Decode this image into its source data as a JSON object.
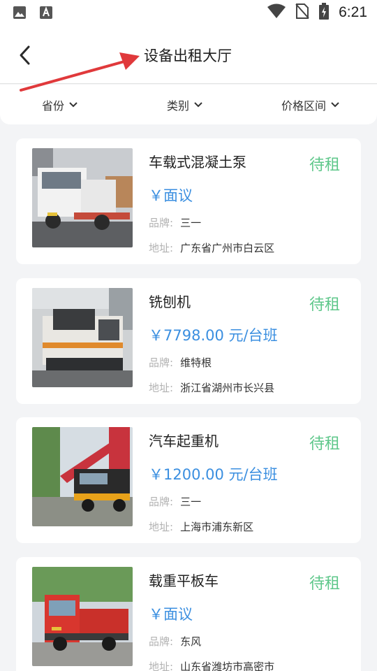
{
  "header": {
    "title": "设备出租大厅"
  },
  "status_bar": {
    "time": "6:21"
  },
  "filters": [
    {
      "label": "省份"
    },
    {
      "label": "类别"
    },
    {
      "label": "价格区间"
    }
  ],
  "labels": {
    "brand": "品牌:",
    "address": "地址:"
  },
  "listings": [
    {
      "name": "车载式混凝土泵",
      "status": "待租",
      "price": "￥面议",
      "brand": "三一",
      "address": "广东省广州市白云区"
    },
    {
      "name": "铣刨机",
      "status": "待租",
      "price": "￥7798.00 元/台班",
      "brand": "维特根",
      "address": "浙江省湖州市长兴县"
    },
    {
      "name": "汽车起重机",
      "status": "待租",
      "price": "￥1200.00 元/台班",
      "brand": "三一",
      "address": "上海市浦东新区"
    },
    {
      "name": "载重平板车",
      "status": "待租",
      "price": "￥面议",
      "brand": "东风",
      "address": "山东省潍坊市高密市"
    }
  ],
  "colors": {
    "status": "#5ec78a",
    "price": "#3b8fe0",
    "annotation_arrow": "#e0393b"
  }
}
